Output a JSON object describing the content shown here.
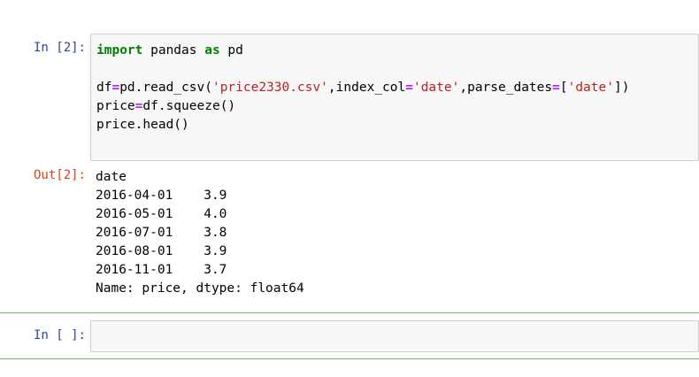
{
  "cell1": {
    "prompt": "In [2]:",
    "code": {
      "l1_kw1": "import",
      "l1_mid": " pandas ",
      "l1_kw2": "as",
      "l1_end": " pd",
      "l3_a": "df",
      "l3_eq": "=",
      "l3_b": "pd.read_csv(",
      "l3_s1": "'price2330.csv'",
      "l3_c": ",index_col",
      "l3_eq2": "=",
      "l3_s2": "'date'",
      "l3_d": ",parse_dates",
      "l3_eq3": "=",
      "l3_e": "[",
      "l3_s3": "'date'",
      "l3_f": "])",
      "l4_a": "price",
      "l4_eq": "=",
      "l4_b": "df.squeeze()",
      "l5": "price.head()"
    }
  },
  "output1": {
    "prompt": "Out[2]:",
    "lines": [
      "date",
      "2016-04-01    3.9",
      "2016-05-01    4.0",
      "2016-07-01    3.8",
      "2016-08-01    3.9",
      "2016-11-01    3.7",
      "Name: price, dtype: float64"
    ]
  },
  "cell2": {
    "prompt": "In [ ]:",
    "code": ""
  },
  "colors": {
    "keyword": "#008000",
    "operator": "#aa22ff",
    "string": "#ba2121",
    "in_prompt": "#303f9f",
    "out_prompt": "#d84315",
    "divider": "#66bb6a"
  }
}
